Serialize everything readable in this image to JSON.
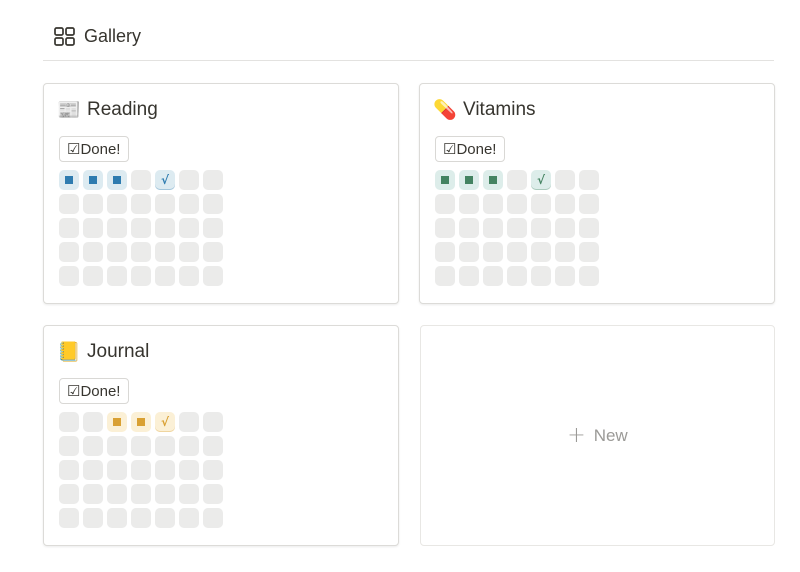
{
  "header": {
    "title": "Gallery",
    "icon": "gallery-grid-icon"
  },
  "cards": [
    {
      "name": "Reading",
      "emoji": "📰",
      "emoji_icon": "newspaper-icon",
      "button_label": "☑Done!",
      "color": "#2e7cb0",
      "tint": "#ddebf1",
      "check_glyph": "√",
      "cells": [
        "filled",
        "filled",
        "filled",
        "empty",
        "check",
        "empty",
        "empty",
        "empty",
        "empty",
        "empty",
        "empty",
        "empty",
        "empty",
        "empty",
        "empty",
        "empty",
        "empty",
        "empty",
        "empty",
        "empty",
        "empty",
        "empty",
        "empty",
        "empty",
        "empty",
        "empty",
        "empty",
        "empty",
        "empty",
        "empty",
        "empty",
        "empty",
        "empty",
        "empty",
        "empty"
      ]
    },
    {
      "name": "Vitamins",
      "emoji": "💊",
      "emoji_icon": "pill-icon",
      "button_label": "☑Done!",
      "color": "#448361",
      "tint": "#ddedea",
      "check_glyph": "√",
      "cells": [
        "filled",
        "filled",
        "filled",
        "empty",
        "check",
        "empty",
        "empty",
        "empty",
        "empty",
        "empty",
        "empty",
        "empty",
        "empty",
        "empty",
        "empty",
        "empty",
        "empty",
        "empty",
        "empty",
        "empty",
        "empty",
        "empty",
        "empty",
        "empty",
        "empty",
        "empty",
        "empty",
        "empty",
        "empty",
        "empty",
        "empty",
        "empty",
        "empty",
        "empty",
        "empty"
      ]
    },
    {
      "name": "Journal",
      "emoji": "📒",
      "emoji_icon": "notebook-icon",
      "button_label": "☑Done!",
      "color": "#d9a032",
      "tint": "#fbf0d6",
      "check_glyph": "√",
      "cells": [
        "empty",
        "empty",
        "filled",
        "filled",
        "check",
        "empty",
        "empty",
        "empty",
        "empty",
        "empty",
        "empty",
        "empty",
        "empty",
        "empty",
        "empty",
        "empty",
        "empty",
        "empty",
        "empty",
        "empty",
        "empty",
        "empty",
        "empty",
        "empty",
        "empty",
        "empty",
        "empty",
        "empty",
        "empty",
        "empty",
        "empty",
        "empty",
        "empty",
        "empty",
        "empty"
      ]
    }
  ],
  "new_card": {
    "label": "New",
    "plus_glyph": "+"
  }
}
